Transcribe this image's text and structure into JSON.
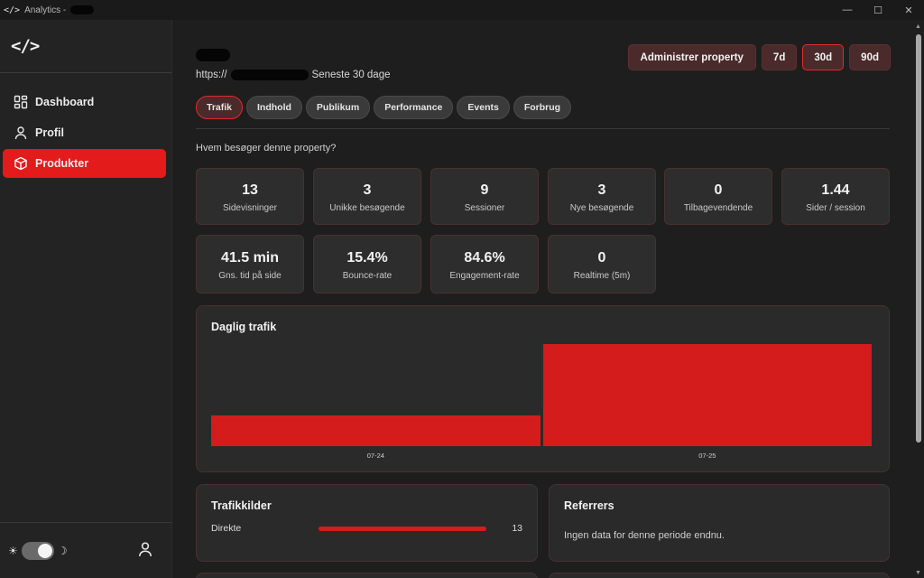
{
  "window": {
    "app_name": "Analytics -",
    "logo_text": "</>",
    "controls": {
      "minimize": "—",
      "maximize": "☐",
      "close": "✕"
    }
  },
  "sidebar": {
    "brand": "</>",
    "items": [
      {
        "label": "Dashboard",
        "icon": "grid-icon",
        "active": false
      },
      {
        "label": "Profil",
        "icon": "user-icon",
        "active": false
      },
      {
        "label": "Produkter",
        "icon": "box-icon",
        "active": true
      }
    ],
    "theme": {
      "sun": "☀",
      "moon": "☽",
      "dark_mode": true
    }
  },
  "header": {
    "url_prefix": "https://",
    "period_text": "Seneste 30 dage",
    "manage_label": "Administrer property",
    "ranges": [
      "7d",
      "30d",
      "90d"
    ],
    "selected_range": "30d"
  },
  "tabs": [
    "Trafik",
    "Indhold",
    "Publikum",
    "Performance",
    "Events",
    "Forbrug"
  ],
  "active_tab": "Trafik",
  "question": "Hvem besøger denne property?",
  "kpis_row1": [
    {
      "value": "13",
      "label": "Sidevisninger"
    },
    {
      "value": "3",
      "label": "Unikke besøgende"
    },
    {
      "value": "9",
      "label": "Sessioner"
    },
    {
      "value": "3",
      "label": "Nye besøgende"
    },
    {
      "value": "0",
      "label": "Tilbagevendende"
    },
    {
      "value": "1.44",
      "label": "Sider / session"
    }
  ],
  "kpis_row2": [
    {
      "value": "41.5 min",
      "label": "Gns. tid på side"
    },
    {
      "value": "15.4%",
      "label": "Bounce-rate"
    },
    {
      "value": "84.6%",
      "label": "Engagement-rate"
    },
    {
      "value": "0",
      "label": "Realtime (5m)"
    }
  ],
  "daily_traffic": {
    "title": "Daglig trafik"
  },
  "chart_data": {
    "type": "bar",
    "title": "Daglig trafik",
    "categories": [
      "07-24",
      "07-25"
    ],
    "values": [
      3,
      10
    ],
    "xlabel": "",
    "ylabel": "",
    "grid": false
  },
  "sources": {
    "title": "Trafikkilder",
    "items": [
      {
        "label": "Direkte",
        "count": "13",
        "fraction": 1.0
      }
    ]
  },
  "referrers": {
    "title": "Referrers",
    "empty_text": "Ingen data for denne periode endnu."
  },
  "colors": {
    "accent": "#e31b1b",
    "bar": "#d41c1c",
    "card_bg": "#2a2a2a",
    "page_bg": "#1e1e1e"
  }
}
